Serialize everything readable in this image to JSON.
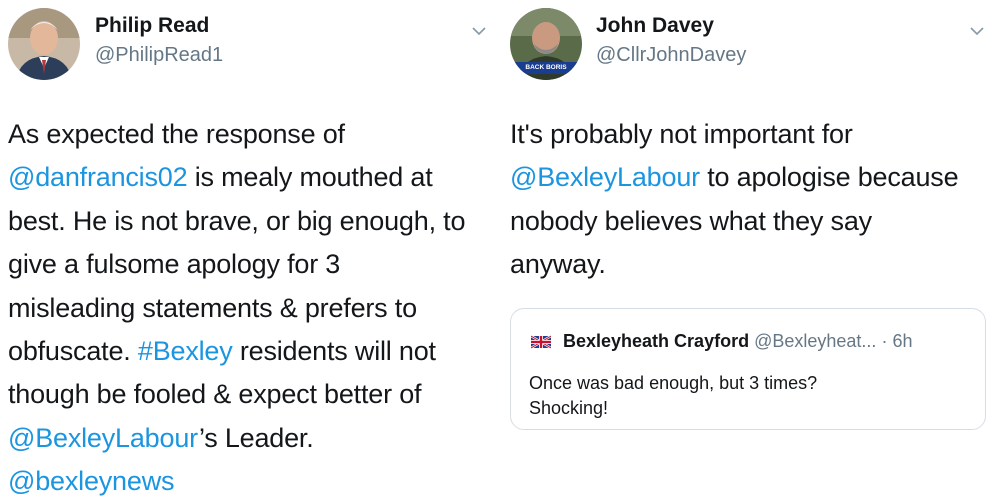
{
  "tweets": [
    {
      "author": {
        "name": "Philip Read",
        "handle": "@PhilipRead1"
      },
      "lines": [
        [
          {
            "text": "As expected the response of",
            "link": false
          }
        ],
        [
          {
            "text": "@danfrancis02",
            "link": true
          },
          {
            "text": " is mealy mouthed at",
            "link": false
          }
        ],
        [
          {
            "text": "best. He is not brave, or big enough, to",
            "link": false
          }
        ],
        [
          {
            "text": "give a fulsome apology for 3",
            "link": false
          }
        ],
        [
          {
            "text": "misleading statements & prefers to",
            "link": false
          }
        ],
        [
          {
            "text": "obfuscate. ",
            "link": false
          },
          {
            "text": "#Bexley",
            "link": true
          },
          {
            "text": " residents will not",
            "link": false
          }
        ],
        [
          {
            "text": "though be fooled & expect better of",
            "link": false
          }
        ],
        [
          {
            "text": "@BexleyLabour",
            "link": true
          },
          {
            "text": "’s Leader.",
            "link": false
          }
        ],
        [
          {
            "text": "@bexleynews",
            "link": true
          }
        ]
      ]
    },
    {
      "author": {
        "name": "John Davey",
        "handle": "@CllrJohnDavey",
        "avatar_badge": "BACK BORIS"
      },
      "lines": [
        [
          {
            "text": "It's probably not important for",
            "link": false
          }
        ],
        [
          {
            "text": "@BexleyLabour",
            "link": true
          },
          {
            "text": " to apologise because",
            "link": false
          }
        ],
        [
          {
            "text": "nobody believes what they say",
            "link": false
          }
        ],
        [
          {
            "text": "anyway.",
            "link": false
          }
        ]
      ],
      "quoted": {
        "name": "Bexleyheath Crayford",
        "handle": "@Bexleyheat...",
        "time": "· 6h",
        "text_lines": [
          "Once was bad enough, but 3 times?",
          "Shocking!"
        ]
      }
    }
  ],
  "icons": {
    "caret": "chevron-down-icon",
    "flag": "union-flag-icon"
  },
  "colors": {
    "link": "#1b95e0",
    "secondary": "#657786",
    "border": "#d6dee4"
  }
}
